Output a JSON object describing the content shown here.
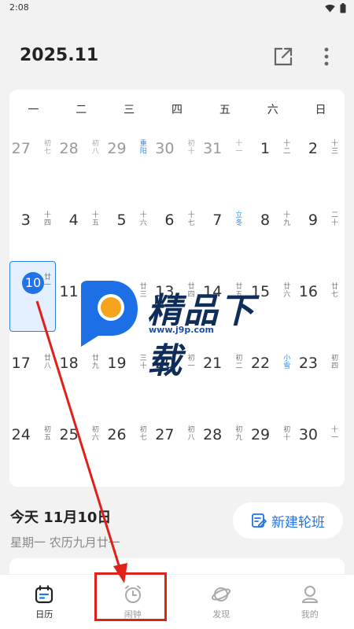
{
  "status_bar": {
    "time": "2:08"
  },
  "header": {
    "title": "2025.11"
  },
  "weekdays": [
    "一",
    "二",
    "三",
    "四",
    "五",
    "六",
    "日"
  ],
  "days": [
    {
      "day": "27",
      "lunar": "初七",
      "dim": true
    },
    {
      "day": "28",
      "lunar": "初八",
      "dim": true
    },
    {
      "day": "29",
      "lunar": "重阳",
      "dim": true,
      "festival": true
    },
    {
      "day": "30",
      "lunar": "初十",
      "dim": true
    },
    {
      "day": "31",
      "lunar": "十一",
      "dim": true
    },
    {
      "day": "1",
      "lunar": "十二"
    },
    {
      "day": "2",
      "lunar": "十三"
    },
    {
      "day": "3",
      "lunar": "十四"
    },
    {
      "day": "4",
      "lunar": "十五"
    },
    {
      "day": "5",
      "lunar": "十六"
    },
    {
      "day": "6",
      "lunar": "十七"
    },
    {
      "day": "7",
      "lunar": "立冬",
      "festival": true
    },
    {
      "day": "8",
      "lunar": "十九"
    },
    {
      "day": "9",
      "lunar": "二十"
    },
    {
      "day": "10",
      "lunar": "廿一",
      "today": true
    },
    {
      "day": "11",
      "lunar": "廿二"
    },
    {
      "day": "12",
      "lunar": "廿三"
    },
    {
      "day": "13",
      "lunar": "廿四"
    },
    {
      "day": "14",
      "lunar": "廿五"
    },
    {
      "day": "15",
      "lunar": "廿六"
    },
    {
      "day": "16",
      "lunar": "廿七"
    },
    {
      "day": "17",
      "lunar": "廿八"
    },
    {
      "day": "18",
      "lunar": "廿九"
    },
    {
      "day": "19",
      "lunar": "三十"
    },
    {
      "day": "20",
      "lunar": "初一"
    },
    {
      "day": "21",
      "lunar": "初二"
    },
    {
      "day": "22",
      "lunar": "小雪",
      "festival": true
    },
    {
      "day": "23",
      "lunar": "初四"
    },
    {
      "day": "24",
      "lunar": "初五"
    },
    {
      "day": "25",
      "lunar": "初六"
    },
    {
      "day": "26",
      "lunar": "初七"
    },
    {
      "day": "27",
      "lunar": "初八"
    },
    {
      "day": "28",
      "lunar": "初九"
    },
    {
      "day": "29",
      "lunar": "初十"
    },
    {
      "day": "30",
      "lunar": "十一"
    }
  ],
  "today_info": {
    "title": "今天 11月10日",
    "subtitle": "星期一 农历九月廿一",
    "new_shift_label": "新建轮班"
  },
  "tabs": [
    {
      "id": "calendar",
      "label": "日历",
      "active": true
    },
    {
      "id": "alarm",
      "label": "闹钟"
    },
    {
      "id": "discover",
      "label": "发现"
    },
    {
      "id": "mine",
      "label": "我的"
    }
  ],
  "watermark": {
    "text": "精品下载",
    "url": "www.j9p.com"
  },
  "colors": {
    "accent": "#2273e8",
    "annotation": "#e0211a",
    "festival": "#3c8dde"
  }
}
